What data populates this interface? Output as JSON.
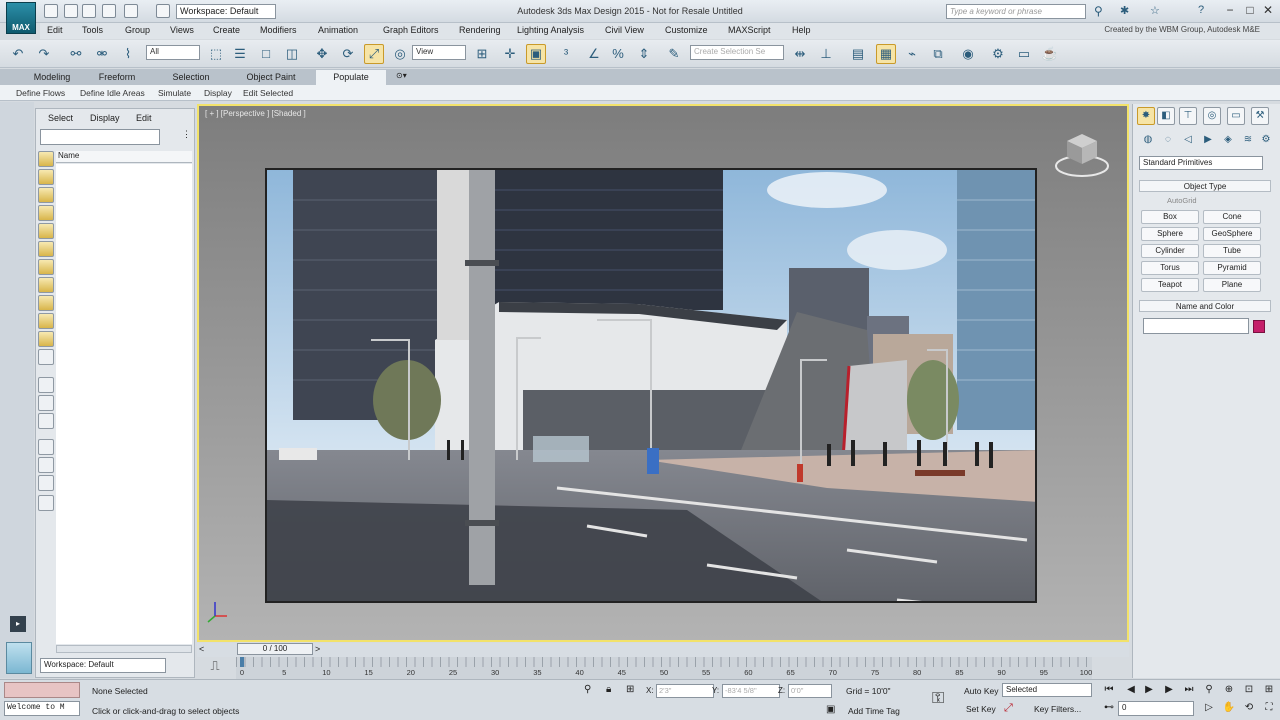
{
  "app": {
    "title": "Autodesk 3ds Max Design 2015  -  Not for Resale   Untitled",
    "workspace": "Workspace: Default",
    "logo_text": "MAX",
    "search_placeholder": "Type a keyword or phrase",
    "credit": "Created by the WBM Group, Autodesk M&E"
  },
  "menu": [
    "Edit",
    "Tools",
    "Group",
    "Views",
    "Create",
    "Modifiers",
    "Animation",
    "Graph Editors",
    "Rendering",
    "Lighting Analysis",
    "Civil View",
    "Customize",
    "MAXScript",
    "Help"
  ],
  "toolbar": {
    "selection_filter": "All",
    "ref_coord": "View",
    "named_selection_placeholder": "Create Selection Se"
  },
  "ribbon": {
    "tabs": [
      "Modeling",
      "Freeform",
      "Selection",
      "Object Paint",
      "Populate"
    ],
    "active_tab": "Populate",
    "sub_items": [
      "Define Flows",
      "Define Idle Areas",
      "Simulate",
      "Display",
      "Edit Selected"
    ]
  },
  "scene_explorer": {
    "tabs": [
      "Select",
      "Display",
      "Edit"
    ],
    "column_header": "Name",
    "workspace": "Workspace: Default"
  },
  "viewport": {
    "label": "[ + ] [Perspective ] [Shaded ]"
  },
  "command_panel": {
    "dropdown": "Standard Primitives",
    "object_type_title": "Object Type",
    "autogrid": "AutoGrid",
    "buttons": [
      "Box",
      "Cone",
      "Sphere",
      "GeoSphere",
      "Cylinder",
      "Tube",
      "Torus",
      "Pyramid",
      "Teapot",
      "Plane"
    ],
    "name_color_title": "Name and Color",
    "object_color": "#c51f6a"
  },
  "timeline": {
    "frame_display": "0 / 100",
    "ticks": [
      "0",
      "5",
      "10",
      "15",
      "20",
      "25",
      "30",
      "35",
      "40",
      "45",
      "50",
      "55",
      "60",
      "65",
      "70",
      "75",
      "80",
      "85",
      "90",
      "95",
      "100"
    ]
  },
  "status": {
    "listener_text": "Welcome to M",
    "selection_status": "None Selected",
    "prompt": "Click or click-and-drag to select objects",
    "x_label": "X:",
    "x_value": "2'3\"",
    "y_label": "Y:",
    "y_value": "-83'4 5/8\"",
    "z_label": "Z:",
    "z_value": "0'0\"",
    "grid": "Grid = 10'0\"",
    "add_time_tag": "Add Time Tag",
    "auto_key": "Auto Key",
    "set_key": "Set Key",
    "key_mode": "Selected",
    "key_filters": "Key Filters...",
    "current_frame": "0"
  }
}
